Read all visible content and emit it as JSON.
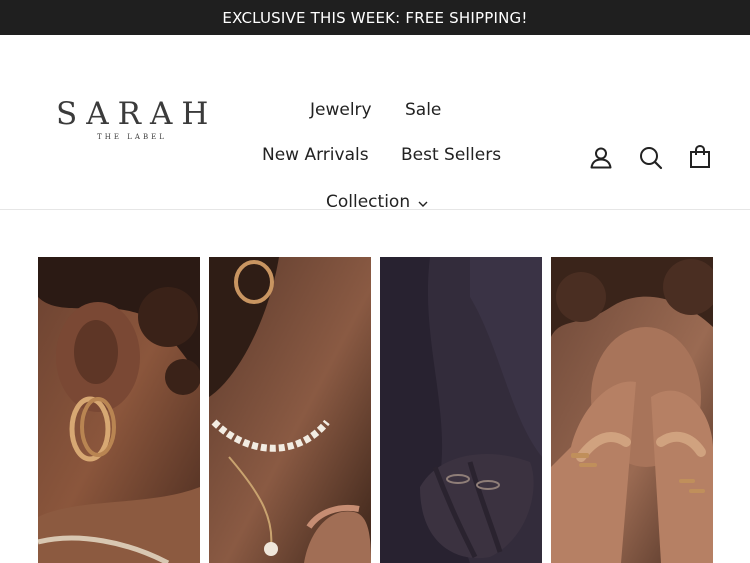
{
  "announcement": {
    "text": "EXCLUSIVE THIS WEEK: FREE SHIPPING!"
  },
  "brand": {
    "name": "SARAH",
    "tagline": "THE LABEL"
  },
  "nav": {
    "jewelry": "Jewelry",
    "sale": "Sale",
    "new_arrivals": "New Arrivals",
    "best_sellers": "Best Sellers",
    "collection": "Collection"
  },
  "header_icons": [
    "account-icon",
    "search-icon",
    "cart-icon"
  ],
  "gallery": {
    "tiles": [
      {
        "subject": "hoop-earrings-photo"
      },
      {
        "subject": "pearl-necklace-photo"
      },
      {
        "subject": "rings-on-hand-photo"
      },
      {
        "subject": "stacked-rings-face-photo"
      }
    ]
  },
  "colors": {
    "announcement_bg": "#1f1f1f",
    "announcement_text": "#ffffff",
    "text": "#222222"
  }
}
